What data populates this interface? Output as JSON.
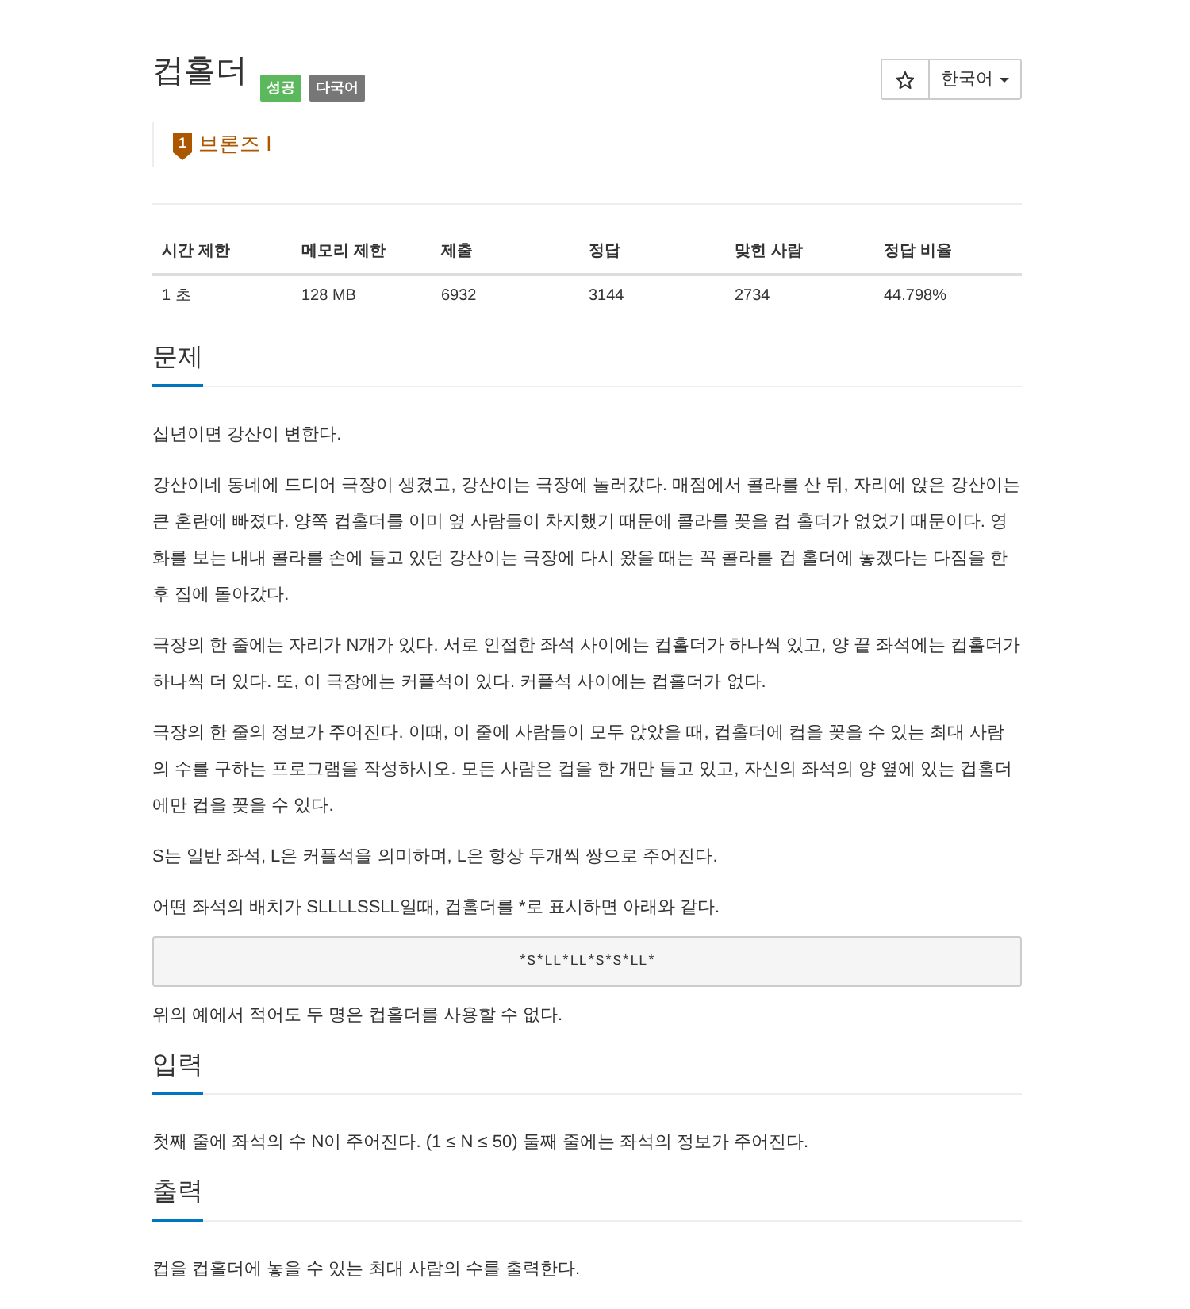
{
  "header": {
    "title": "컵홀더",
    "badges": [
      {
        "label": "성공",
        "kind": "success"
      },
      {
        "label": "다국어",
        "kind": "multilang"
      }
    ],
    "tier": {
      "number": "1",
      "label": "브론즈 I",
      "kind": "bronze"
    }
  },
  "toolbar": {
    "favorite": {
      "on": false
    },
    "language": "한국어"
  },
  "stats_table": {
    "columns": [
      "시간 제한",
      "메모리 제한",
      "제출",
      "정답",
      "맞힌 사람",
      "정답 비율"
    ],
    "rows": [
      [
        "1 초",
        "128 MB",
        "6932",
        "3144",
        "2734",
        "44.798%"
      ]
    ]
  },
  "sections": [
    {
      "heading": "문제",
      "blocks": [
        {
          "kind": "text",
          "text": "십년이면 강산이 변한다."
        },
        {
          "kind": "text",
          "text": "강산이네 동네에 드디어 극장이 생겼고, 강산이는 극장에 놀러갔다. 매점에서 콜라를 산 뒤, 자리에 앉은 강산이는 큰 혼란에 빠졌다. 양쪽 컵홀더를 이미 옆 사람들이 차지했기 때문에 콜라를 꽂을 컵 홀더가 없었기 때문이다. 영화를 보는 내내 콜라를 손에 들고 있던 강산이는 극장에 다시 왔을 때는 꼭 콜라를 컵 홀더에 놓겠다는 다짐을 한 후 집에 돌아갔다."
        },
        {
          "kind": "text",
          "text": "극장의 한 줄에는 자리가 N개가 있다. 서로 인접한 좌석 사이에는 컵홀더가 하나씩 있고, 양 끝 좌석에는 컵홀더가 하나씩 더 있다. 또, 이 극장에는 커플석이 있다. 커플석 사이에는 컵홀더가 없다."
        },
        {
          "kind": "text",
          "text": "극장의 한 줄의 정보가 주어진다. 이때, 이 줄에 사람들이 모두 앉았을 때, 컵홀더에 컵을 꽂을 수 있는 최대 사람의 수를 구하는 프로그램을 작성하시오. 모든 사람은 컵을 한 개만 들고 있고, 자신의 좌석의 양 옆에 있는 컵홀더에만 컵을 꽂을 수 있다."
        },
        {
          "kind": "text",
          "text": "S는 일반 좌석, L은 커플석을 의미하며, L은 항상 두개씩 쌍으로 주어진다."
        },
        {
          "kind": "text",
          "text": "어떤 좌석의 배치가 SLLLLSSLL일때, 컵홀더를 *로 표시하면 아래와 같다."
        },
        {
          "kind": "code",
          "text": "*S*LL*LL*S*S*LL*"
        },
        {
          "kind": "text",
          "text": "위의 예에서 적어도 두 명은 컵홀더를 사용할 수 없다."
        }
      ]
    },
    {
      "heading": "입력",
      "blocks": [
        {
          "kind": "text",
          "text": "첫째 줄에 좌석의 수 N이 주어진다. (1 ≤ N ≤ 50) 둘째 줄에는 좌석의 정보가 주어진다."
        }
      ]
    },
    {
      "heading": "출력",
      "blocks": [
        {
          "kind": "text",
          "text": "컵을 컵홀더에 놓을 수 있는 최대 사람의 수를 출력한다."
        }
      ]
    }
  ]
}
